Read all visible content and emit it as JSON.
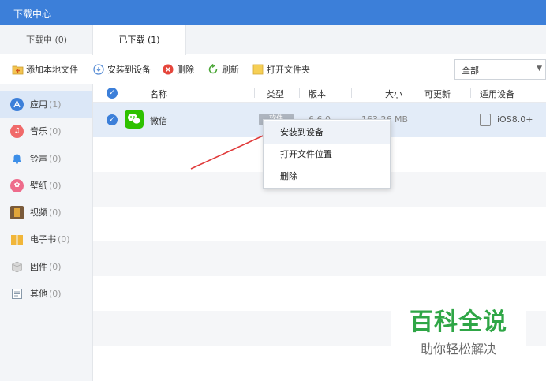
{
  "window": {
    "title": "下载中心"
  },
  "tabs": [
    {
      "label": "下载中 (0)"
    },
    {
      "label": "已下载 (1)"
    }
  ],
  "toolbar": {
    "add_local": "添加本地文件",
    "install": "安装到设备",
    "delete": "删除",
    "refresh": "刷新",
    "open_folder": "打开文件夹",
    "filter_value": "全部"
  },
  "sidebar": {
    "items": [
      {
        "label": "应用",
        "count": "(1)",
        "icon": "app-store-icon",
        "color": "#3c7fd9"
      },
      {
        "label": "音乐",
        "count": "(0)",
        "icon": "music-icon",
        "color": "#f06a6a"
      },
      {
        "label": "铃声",
        "count": "(0)",
        "icon": "bell-icon",
        "color": "#3c8ee8"
      },
      {
        "label": "壁纸",
        "count": "(0)",
        "icon": "wallpaper-icon",
        "color": "#ee6b8b"
      },
      {
        "label": "视频",
        "count": "(0)",
        "icon": "film-icon",
        "color": "#e1a53a"
      },
      {
        "label": "电子书",
        "count": "(0)",
        "icon": "book-icon",
        "color": "#f1b63a"
      },
      {
        "label": "固件",
        "count": "(0)",
        "icon": "box-icon",
        "color": "#bbbbbb"
      },
      {
        "label": "其他",
        "count": "(0)",
        "icon": "document-icon",
        "color": "#8899aa"
      }
    ]
  },
  "table": {
    "headers": {
      "name": "名称",
      "type": "类型",
      "version": "版本",
      "size": "大小",
      "updatable": "可更新",
      "device": "适用设备"
    },
    "rows": [
      {
        "name": "微信",
        "type": "软件",
        "version": "6.6.0",
        "size": "163.26 MB",
        "device": "iOS8.0+"
      }
    ]
  },
  "context_menu": {
    "items": [
      {
        "label": "安装到设备"
      },
      {
        "label": "打开文件位置"
      },
      {
        "label": "删除"
      }
    ]
  },
  "watermark": {
    "title": "百科全说",
    "subtitle": "助你轻松解决"
  },
  "colors": {
    "accent": "#3c7fd9",
    "wechat_green": "#2dc100",
    "arrow_red": "#e03a3a"
  }
}
